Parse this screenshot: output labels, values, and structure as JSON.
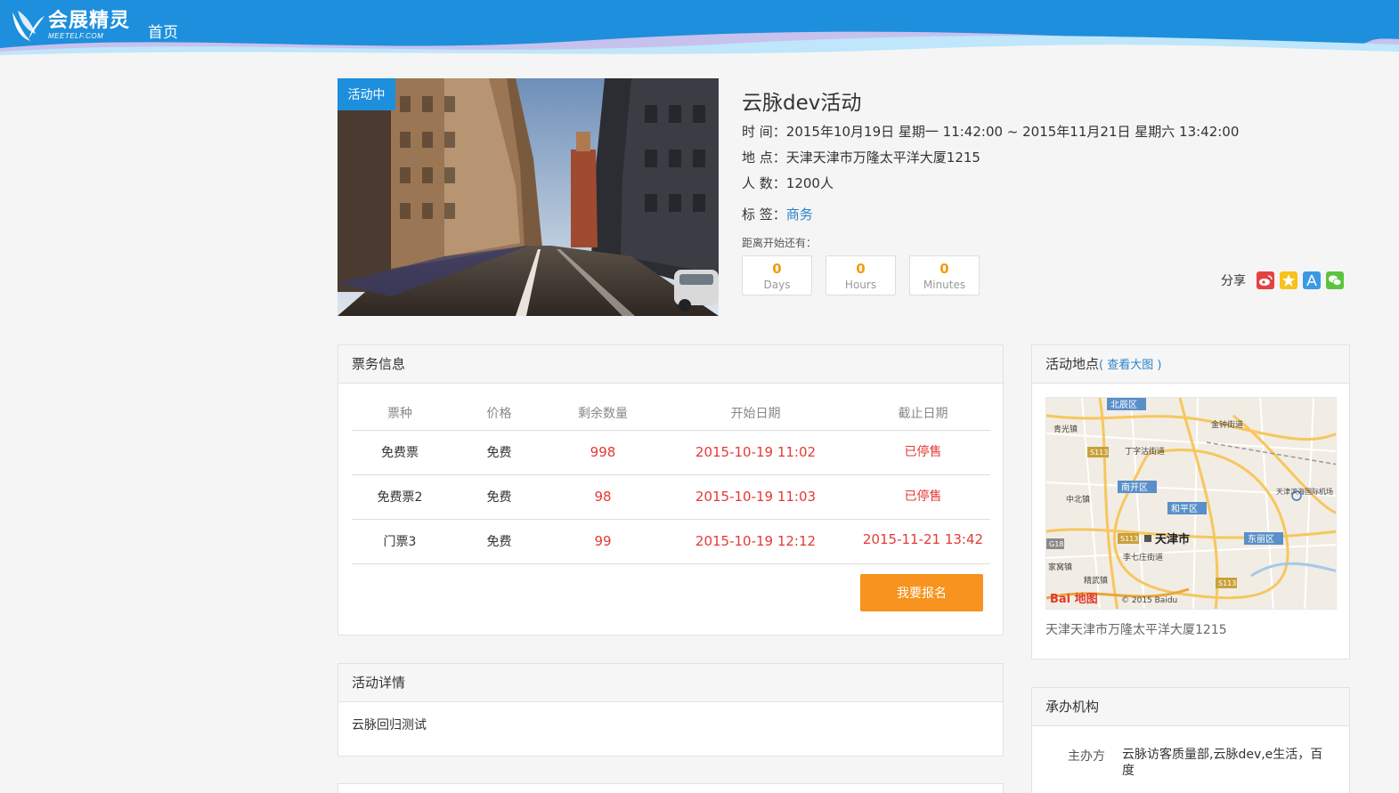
{
  "header": {
    "logo_name": "会展精灵",
    "logo_sub": "MEETELF.COM",
    "nav_home": "首页",
    "brand_color": "#1e8fdc"
  },
  "event": {
    "status_badge": "活动中",
    "title": "云脉dev活动",
    "time_label": "时 间：",
    "time_value": "2015年10月19日 星期一 11:42:00 ~ 2015年11月21日 星期六 13:42:00",
    "place_label": "地 点：",
    "place_value": "天津天津市万隆太平洋大厦1215",
    "people_label": "人 数：",
    "people_value": "1200人",
    "tag_label": "标 签：",
    "tag_value": "商务",
    "countdown_label": "距离开始还有：",
    "countdown": [
      {
        "num": "0",
        "unit": "Days"
      },
      {
        "num": "0",
        "unit": "Hours"
      },
      {
        "num": "0",
        "unit": "Minutes"
      }
    ],
    "share_label": "分享",
    "share_icons": [
      "weibo-icon",
      "qzone-icon",
      "tencent-weibo-icon",
      "wechat-icon"
    ]
  },
  "tickets": {
    "title": "票务信息",
    "columns": [
      "票种",
      "价格",
      "剩余数量",
      "开始日期",
      "截止日期"
    ],
    "rows": [
      {
        "name": "免费票",
        "price": "免费",
        "remaining": "998",
        "start": "2015-10-19 11:02",
        "end": "已停售"
      },
      {
        "name": "免费票2",
        "price": "免费",
        "remaining": "98",
        "start": "2015-10-19 11:03",
        "end": "已停售"
      },
      {
        "name": "门票3",
        "price": "免费",
        "remaining": "99",
        "start": "2015-10-19 12:12",
        "end": "2015-11-21 13:42"
      }
    ],
    "signup_button": "我要报名",
    "accent_color": "#f7931e",
    "alert_color": "#e53935"
  },
  "details": {
    "title": "活动详情",
    "text": "云脉回归测试"
  },
  "location": {
    "title": "活动地点",
    "map_link": "( 查看大图 )",
    "address": "天津天津市万隆太平洋大厦1215",
    "map_labels": {
      "city": "天津市",
      "beichen": "北辰区",
      "nankai": "南开区",
      "heping": "和平区",
      "dongli": "东丽区",
      "qingguang": "青光镇",
      "jinzhong": "金钟街道",
      "dingzigu": "丁字沽街道",
      "zhongbei": "中北镇",
      "airport": "天津滨海国际机场",
      "qizhuang": "李七庄街道",
      "jiawo": "家窝镇",
      "jingwu": "精武镇",
      "s113a": "S113",
      "s113b": "S113",
      "s113c": "S113",
      "g18": "G18",
      "baidu_logo": "Bai 地图",
      "copyright": "© 2015 Baidu"
    }
  },
  "organizer": {
    "title": "承办机构",
    "label": "主办方",
    "value": "云脉访客质量部,云脉dev,e生活，百度"
  }
}
